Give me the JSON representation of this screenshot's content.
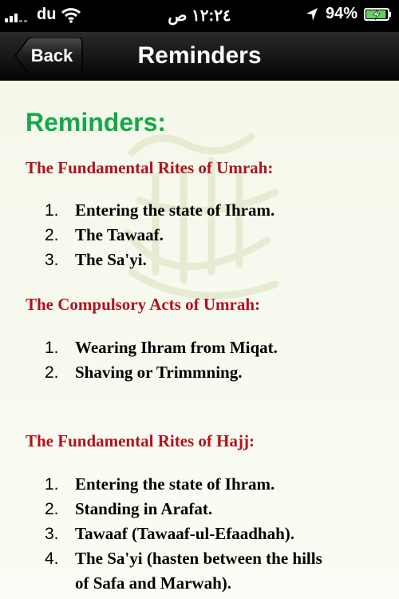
{
  "status": {
    "carrier": "du",
    "time": "١٢:٢٤ ص",
    "battery_percent": "94%",
    "battery_level": 0.94
  },
  "nav": {
    "back_label": "Back",
    "title": "Reminders"
  },
  "main": {
    "heading": "Reminders:",
    "sections": [
      {
        "title": "The Fundamental Rites of Umrah:",
        "items": [
          {
            "num": "1.",
            "text": "Entering the state of Ihram."
          },
          {
            "num": "2.",
            "text": "The Tawaaf."
          },
          {
            "num": "3.",
            "text": "The Sa'yi."
          }
        ]
      },
      {
        "title": "The Compulsory Acts of Umrah:",
        "items": [
          {
            "num": "1.",
            "text": "Wearing Ihram from Miqat."
          },
          {
            "num": "2.",
            "text": "Shaving or Trimmning."
          }
        ]
      },
      {
        "title": "The Fundamental Rites of Hajj:",
        "items": [
          {
            "num": "1.",
            "text": "Entering the state of Ihram."
          },
          {
            "num": "2.",
            "text": "Standing in Arafat."
          },
          {
            "num": "3.",
            "text": "Tawaaf (Tawaaf-ul-Efaadhah)."
          },
          {
            "num": "4.",
            "text": "The Sa'yi (hasten between the hills",
            "text_cont": "of Safa and Marwah)."
          }
        ]
      }
    ]
  },
  "colors": {
    "heading": "#14a84a",
    "section_title": "#b0121e"
  },
  "icons": [
    "signal-bars-icon",
    "wifi-icon",
    "location-arrow-icon",
    "battery-icon"
  ]
}
